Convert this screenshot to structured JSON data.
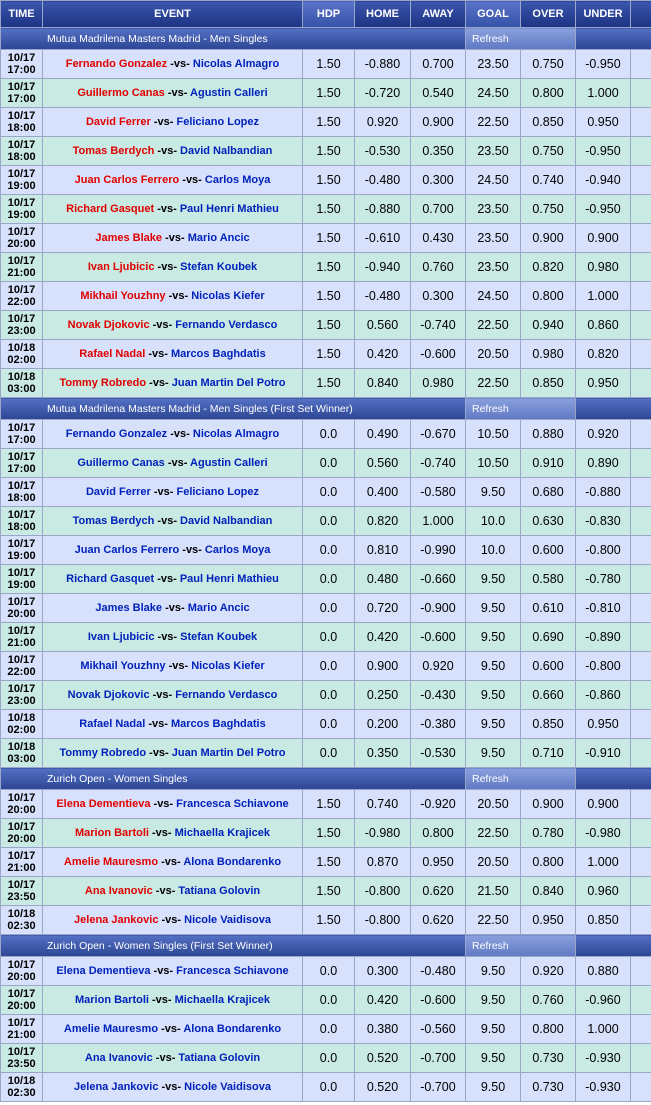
{
  "headers": {
    "time": "TIME",
    "event": "EVENT",
    "hdp": "HDP",
    "home": "HOME",
    "away": "AWAY",
    "goal": "GOAL",
    "over": "OVER",
    "under": "UNDER"
  },
  "sections": [
    {
      "title": "Mutua Madrilena Masters Madrid - Men Singles",
      "refresh": "Refresh",
      "rows": [
        {
          "date": "10/17",
          "time": "17:00",
          "p1": "Fernando Gonzalez",
          "p2": "Nicolas Almagro",
          "fav": 1,
          "hdp": "1.50",
          "home": "-0.880",
          "away": "0.700",
          "goal": "23.50",
          "over": "0.750",
          "under": "-0.950"
        },
        {
          "date": "10/17",
          "time": "17:00",
          "p1": "Guillermo Canas",
          "p2": "Agustin Calleri",
          "fav": 1,
          "hdp": "1.50",
          "home": "-0.720",
          "away": "0.540",
          "goal": "24.50",
          "over": "0.800",
          "under": "1.000"
        },
        {
          "date": "10/17",
          "time": "18:00",
          "p1": "David Ferrer",
          "p2": "Feliciano Lopez",
          "fav": 1,
          "hdp": "1.50",
          "home": "0.920",
          "away": "0.900",
          "goal": "22.50",
          "over": "0.850",
          "under": "0.950"
        },
        {
          "date": "10/17",
          "time": "18:00",
          "p1": "Tomas Berdych",
          "p2": "David Nalbandian",
          "fav": 1,
          "hdp": "1.50",
          "home": "-0.530",
          "away": "0.350",
          "goal": "23.50",
          "over": "0.750",
          "under": "-0.950"
        },
        {
          "date": "10/17",
          "time": "19:00",
          "p1": "Juan Carlos Ferrero",
          "p2": "Carlos Moya",
          "fav": 1,
          "hdp": "1.50",
          "home": "-0.480",
          "away": "0.300",
          "goal": "24.50",
          "over": "0.740",
          "under": "-0.940"
        },
        {
          "date": "10/17",
          "time": "19:00",
          "p1": "Richard Gasquet",
          "p2": "Paul Henri Mathieu",
          "fav": 1,
          "hdp": "1.50",
          "home": "-0.880",
          "away": "0.700",
          "goal": "23.50",
          "over": "0.750",
          "under": "-0.950"
        },
        {
          "date": "10/17",
          "time": "20:00",
          "p1": "James Blake",
          "p2": "Mario Ancic",
          "fav": 1,
          "hdp": "1.50",
          "home": "-0.610",
          "away": "0.430",
          "goal": "23.50",
          "over": "0.900",
          "under": "0.900"
        },
        {
          "date": "10/17",
          "time": "21:00",
          "p1": "Ivan Ljubicic",
          "p2": "Stefan Koubek",
          "fav": 1,
          "hdp": "1.50",
          "home": "-0.940",
          "away": "0.760",
          "goal": "23.50",
          "over": "0.820",
          "under": "0.980"
        },
        {
          "date": "10/17",
          "time": "22:00",
          "p1": "Mikhail Youzhny",
          "p2": "Nicolas Kiefer",
          "fav": 1,
          "hdp": "1.50",
          "home": "-0.480",
          "away": "0.300",
          "goal": "24.50",
          "over": "0.800",
          "under": "1.000"
        },
        {
          "date": "10/17",
          "time": "23:00",
          "p1": "Novak Djokovic",
          "p2": "Fernando Verdasco",
          "fav": 1,
          "hdp": "1.50",
          "home": "0.560",
          "away": "-0.740",
          "goal": "22.50",
          "over": "0.940",
          "under": "0.860"
        },
        {
          "date": "10/18",
          "time": "02:00",
          "p1": "Rafael Nadal",
          "p2": "Marcos Baghdatis",
          "fav": 1,
          "hdp": "1.50",
          "home": "0.420",
          "away": "-0.600",
          "goal": "20.50",
          "over": "0.980",
          "under": "0.820"
        },
        {
          "date": "10/18",
          "time": "03:00",
          "p1": "Tommy Robredo",
          "p2": "Juan Martin Del Potro",
          "fav": 1,
          "hdp": "1.50",
          "home": "0.840",
          "away": "0.980",
          "goal": "22.50",
          "over": "0.850",
          "under": "0.950"
        }
      ]
    },
    {
      "title": "Mutua Madrilena Masters Madrid - Men Singles (First Set Winner)",
      "refresh": "Refresh",
      "rows": [
        {
          "date": "10/17",
          "time": "17:00",
          "p1": "Fernando Gonzalez",
          "p2": "Nicolas Almagro",
          "fav": 0,
          "hdp": "0.0",
          "home": "0.490",
          "away": "-0.670",
          "goal": "10.50",
          "over": "0.880",
          "under": "0.920"
        },
        {
          "date": "10/17",
          "time": "17:00",
          "p1": "Guillermo Canas",
          "p2": "Agustin Calleri",
          "fav": 0,
          "hdp": "0.0",
          "home": "0.560",
          "away": "-0.740",
          "goal": "10.50",
          "over": "0.910",
          "under": "0.890"
        },
        {
          "date": "10/17",
          "time": "18:00",
          "p1": "David Ferrer",
          "p2": "Feliciano Lopez",
          "fav": 0,
          "hdp": "0.0",
          "home": "0.400",
          "away": "-0.580",
          "goal": "9.50",
          "over": "0.680",
          "under": "-0.880"
        },
        {
          "date": "10/17",
          "time": "18:00",
          "p1": "Tomas Berdych",
          "p2": "David Nalbandian",
          "fav": 0,
          "hdp": "0.0",
          "home": "0.820",
          "away": "1.000",
          "goal": "10.0",
          "over": "0.630",
          "under": "-0.830"
        },
        {
          "date": "10/17",
          "time": "19:00",
          "p1": "Juan Carlos Ferrero",
          "p2": "Carlos Moya",
          "fav": 0,
          "hdp": "0.0",
          "home": "0.810",
          "away": "-0.990",
          "goal": "10.0",
          "over": "0.600",
          "under": "-0.800"
        },
        {
          "date": "10/17",
          "time": "19:00",
          "p1": "Richard Gasquet",
          "p2": "Paul Henri Mathieu",
          "fav": 0,
          "hdp": "0.0",
          "home": "0.480",
          "away": "-0.660",
          "goal": "9.50",
          "over": "0.580",
          "under": "-0.780"
        },
        {
          "date": "10/17",
          "time": "20:00",
          "p1": "James Blake",
          "p2": "Mario Ancic",
          "fav": 0,
          "hdp": "0.0",
          "home": "0.720",
          "away": "-0.900",
          "goal": "9.50",
          "over": "0.610",
          "under": "-0.810"
        },
        {
          "date": "10/17",
          "time": "21:00",
          "p1": "Ivan Ljubicic",
          "p2": "Stefan Koubek",
          "fav": 0,
          "hdp": "0.0",
          "home": "0.420",
          "away": "-0.600",
          "goal": "9.50",
          "over": "0.690",
          "under": "-0.890"
        },
        {
          "date": "10/17",
          "time": "22:00",
          "p1": "Mikhail Youzhny",
          "p2": "Nicolas Kiefer",
          "fav": 0,
          "hdp": "0.0",
          "home": "0.900",
          "away": "0.920",
          "goal": "9.50",
          "over": "0.600",
          "under": "-0.800"
        },
        {
          "date": "10/17",
          "time": "23:00",
          "p1": "Novak Djokovic",
          "p2": "Fernando Verdasco",
          "fav": 0,
          "hdp": "0.0",
          "home": "0.250",
          "away": "-0.430",
          "goal": "9.50",
          "over": "0.660",
          "under": "-0.860"
        },
        {
          "date": "10/18",
          "time": "02:00",
          "p1": "Rafael Nadal",
          "p2": "Marcos Baghdatis",
          "fav": 0,
          "hdp": "0.0",
          "home": "0.200",
          "away": "-0.380",
          "goal": "9.50",
          "over": "0.850",
          "under": "0.950"
        },
        {
          "date": "10/18",
          "time": "03:00",
          "p1": "Tommy Robredo",
          "p2": "Juan Martin Del Potro",
          "fav": 0,
          "hdp": "0.0",
          "home": "0.350",
          "away": "-0.530",
          "goal": "9.50",
          "over": "0.710",
          "under": "-0.910"
        }
      ]
    },
    {
      "title": "Zurich Open - Women Singles",
      "refresh": "Refresh",
      "rows": [
        {
          "date": "10/17",
          "time": "20:00",
          "p1": "Elena Dementieva",
          "p2": "Francesca Schiavone",
          "fav": 1,
          "hdp": "1.50",
          "home": "0.740",
          "away": "-0.920",
          "goal": "20.50",
          "over": "0.900",
          "under": "0.900"
        },
        {
          "date": "10/17",
          "time": "20:00",
          "p1": "Marion Bartoli",
          "p2": "Michaella Krajicek",
          "fav": 1,
          "hdp": "1.50",
          "home": "-0.980",
          "away": "0.800",
          "goal": "22.50",
          "over": "0.780",
          "under": "-0.980"
        },
        {
          "date": "10/17",
          "time": "21:00",
          "p1": "Amelie Mauresmo",
          "p2": "Alona Bondarenko",
          "fav": 1,
          "hdp": "1.50",
          "home": "0.870",
          "away": "0.950",
          "goal": "20.50",
          "over": "0.800",
          "under": "1.000"
        },
        {
          "date": "10/17",
          "time": "23:50",
          "p1": "Ana Ivanovic",
          "p2": "Tatiana Golovin",
          "fav": 1,
          "hdp": "1.50",
          "home": "-0.800",
          "away": "0.620",
          "goal": "21.50",
          "over": "0.840",
          "under": "0.960"
        },
        {
          "date": "10/18",
          "time": "02:30",
          "p1": "Jelena Jankovic",
          "p2": "Nicole Vaidisova",
          "fav": 1,
          "hdp": "1.50",
          "home": "-0.800",
          "away": "0.620",
          "goal": "22.50",
          "over": "0.950",
          "under": "0.850"
        }
      ]
    },
    {
      "title": "Zurich Open - Women Singles (First Set Winner)",
      "refresh": "Refresh",
      "rows": [
        {
          "date": "10/17",
          "time": "20:00",
          "p1": "Elena Dementieva",
          "p2": "Francesca Schiavone",
          "fav": 0,
          "hdp": "0.0",
          "home": "0.300",
          "away": "-0.480",
          "goal": "9.50",
          "over": "0.920",
          "under": "0.880"
        },
        {
          "date": "10/17",
          "time": "20:00",
          "p1": "Marion Bartoli",
          "p2": "Michaella Krajicek",
          "fav": 0,
          "hdp": "0.0",
          "home": "0.420",
          "away": "-0.600",
          "goal": "9.50",
          "over": "0.760",
          "under": "-0.960"
        },
        {
          "date": "10/17",
          "time": "21:00",
          "p1": "Amelie Mauresmo",
          "p2": "Alona Bondarenko",
          "fav": 0,
          "hdp": "0.0",
          "home": "0.380",
          "away": "-0.560",
          "goal": "9.50",
          "over": "0.800",
          "under": "1.000"
        },
        {
          "date": "10/17",
          "time": "23:50",
          "p1": "Ana Ivanovic",
          "p2": "Tatiana Golovin",
          "fav": 0,
          "hdp": "0.0",
          "home": "0.520",
          "away": "-0.700",
          "goal": "9.50",
          "over": "0.730",
          "under": "-0.930"
        },
        {
          "date": "10/18",
          "time": "02:30",
          "p1": "Jelena Jankovic",
          "p2": "Nicole Vaidisova",
          "fav": 0,
          "hdp": "0.0",
          "home": "0.520",
          "away": "-0.700",
          "goal": "9.50",
          "over": "0.730",
          "under": "-0.930"
        }
      ]
    }
  ]
}
